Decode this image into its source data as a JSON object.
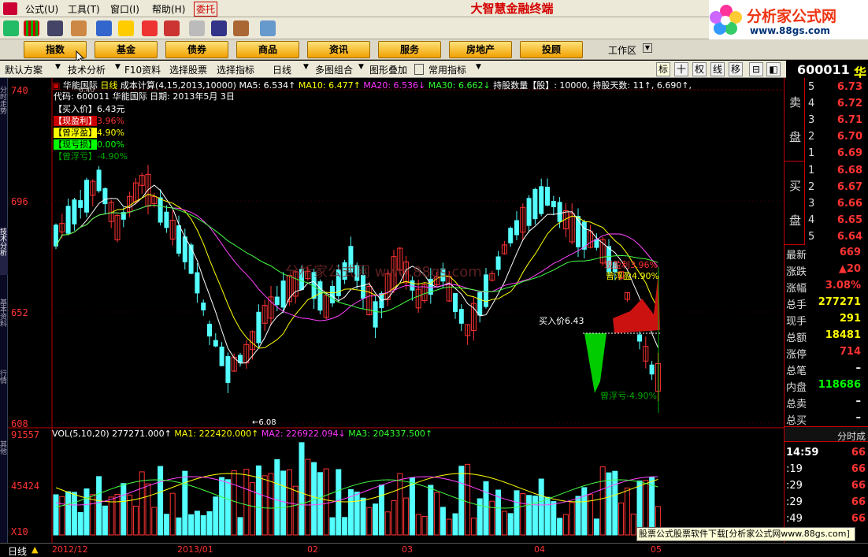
{
  "menu": {
    "items": [
      "公式(U)",
      "工具(T)",
      "窗口(I)",
      "帮助(H)"
    ],
    "weituo": "委托",
    "brand": "大智慧金融终端"
  },
  "logo": {
    "title": "分析家公式网",
    "url": "www.88gs.com"
  },
  "categories": [
    "指数",
    "基金",
    "债券",
    "商品",
    "资讯",
    "服务",
    "房地产",
    "投顾"
  ],
  "workspace": "工作区",
  "tabs": [
    "默认方案",
    "技术分析",
    "F10资料",
    "选择股票",
    "选择指标",
    "日线",
    "多图组合",
    "图形叠加",
    "常用指标"
  ],
  "right_tools": [
    "标",
    "十",
    "权",
    "线",
    "移",
    "⊟",
    "◧"
  ],
  "stock": {
    "code": "600011",
    "name_char": "华",
    "name": "华能国际"
  },
  "chart_header": {
    "name": "华能国际",
    "period": "日线",
    "formula": "成本计算(4,15,2013,10000)",
    "ma5": "MA5: 6.534↑",
    "ma10": "MA10: 6.477↑",
    "ma20": "MA20: 6.536↓",
    "ma30": "MA30: 6.662↓",
    "holding": "持股数量【股】: 10000,",
    "days": "持股天数: 11↑, 6.690↑,",
    "corner": "6.40",
    "code_line": "代码: 600011 华能国际 日期: 2013年5月 3日"
  },
  "info_box": [
    {
      "label": "【买入价】",
      "value": "6.43元",
      "color": "#ffffff"
    },
    {
      "label": "【现盈利】",
      "value": "3.96%",
      "color": "#ff3333"
    },
    {
      "label": "【曾浮盈】",
      "value": "4.90%",
      "color": "#ffff00"
    },
    {
      "label": "【现亏损】",
      "value": "0.00%",
      "color": "#00ff00"
    },
    {
      "label": "【曾浮亏】",
      "value": "-4.90%",
      "color": "#00aa00"
    }
  ],
  "annotations": {
    "buy": "买入价6.43",
    "profit": "现盈利3.96%",
    "float_up": "曾浮盈4.90%",
    "float_down": "曾浮亏-4.90%",
    "low": "6.08",
    "watermark": "分析家公式网 www.88gs.com"
  },
  "price_axis": [
    "740",
    "696",
    "652",
    "608"
  ],
  "vol_header": {
    "vol": "VOL(5,10,20) 277271.000↑",
    "ma1": "MA1: 222420.000↑",
    "ma2": "MA2: 226922.094↓",
    "ma3": "MA3: 204337.500↑"
  },
  "vol_axis": [
    "91557",
    "45424",
    "X10"
  ],
  "date_axis": [
    "2012/12",
    "2013/01",
    "02",
    "03",
    "04",
    "05"
  ],
  "order_book": {
    "sell_label": [
      "卖",
      "盘"
    ],
    "buy_label": [
      "买",
      "盘"
    ],
    "sell": [
      {
        "lvl": "5",
        "price": "6.73"
      },
      {
        "lvl": "4",
        "price": "6.72"
      },
      {
        "lvl": "3",
        "price": "6.71"
      },
      {
        "lvl": "2",
        "price": "6.70"
      },
      {
        "lvl": "1",
        "price": "6.69"
      }
    ],
    "buy": [
      {
        "lvl": "1",
        "price": "6.68"
      },
      {
        "lvl": "2",
        "price": "6.67"
      },
      {
        "lvl": "3",
        "price": "6.66"
      },
      {
        "lvl": "4",
        "price": "6.65"
      },
      {
        "lvl": "5",
        "price": "6.64"
      }
    ]
  },
  "quote": [
    {
      "label": "最新",
      "value": "669",
      "color": "#ff3333"
    },
    {
      "label": "涨跌",
      "value": "▲20",
      "color": "#ff3333"
    },
    {
      "label": "涨幅",
      "value": "3.08%",
      "color": "#ff3333"
    },
    {
      "label": "总手",
      "value": "277271",
      "color": "#ffff00"
    },
    {
      "label": "现手",
      "value": "291",
      "color": "#ffff00"
    },
    {
      "label": "总额",
      "value": "18481",
      "color": "#ffff00"
    },
    {
      "label": "涨停",
      "value": "714",
      "color": "#ff3333"
    },
    {
      "label": "总笔",
      "value": "–",
      "color": "#ffffff"
    },
    {
      "label": "内盘",
      "value": "118686",
      "color": "#00ff00"
    },
    {
      "label": "总卖",
      "value": "–",
      "color": "#ffffff"
    },
    {
      "label": "总买",
      "value": "–",
      "color": "#ffffff"
    }
  ],
  "ticks_header": "分时成",
  "ticks": [
    {
      "t": "14:59",
      "p": "66"
    },
    {
      "t": ":19",
      "p": "66"
    },
    {
      "t": ":29",
      "p": "66"
    },
    {
      "t": ":29",
      "p": "66"
    },
    {
      "t": ":49",
      "p": "66"
    }
  ],
  "left_tabs": [
    "分时走势",
    "技术分析",
    "基本资料",
    "行情",
    "其他"
  ],
  "status": {
    "period": "日线",
    "ad": "股票公式股票软件下载[分析家公式网www.88gs.com]"
  }
}
